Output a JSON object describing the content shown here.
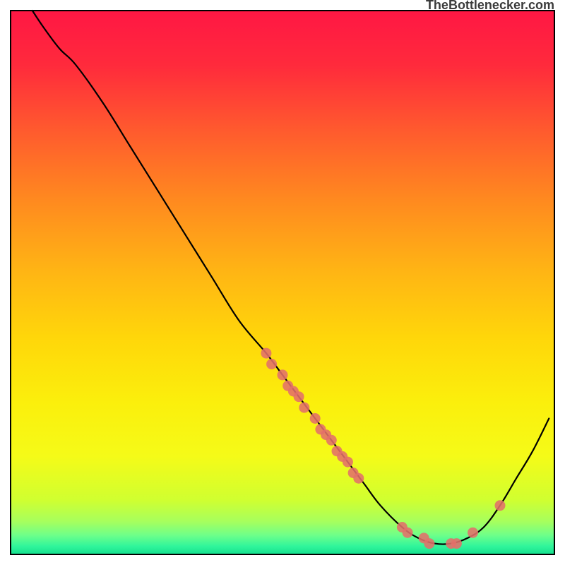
{
  "watermark": "TheBottlenecker.com",
  "chart_data": {
    "type": "line",
    "title": "",
    "xlabel": "",
    "ylabel": "",
    "xlim": [
      0,
      100
    ],
    "ylim": [
      0,
      100
    ],
    "curve": [
      {
        "x": 4,
        "y": 100
      },
      {
        "x": 6,
        "y": 97
      },
      {
        "x": 9,
        "y": 93
      },
      {
        "x": 12,
        "y": 90
      },
      {
        "x": 17,
        "y": 83
      },
      {
        "x": 22,
        "y": 75
      },
      {
        "x": 27,
        "y": 67
      },
      {
        "x": 32,
        "y": 59
      },
      {
        "x": 37,
        "y": 51
      },
      {
        "x": 42,
        "y": 43
      },
      {
        "x": 47,
        "y": 37
      },
      {
        "x": 50,
        "y": 33
      },
      {
        "x": 53,
        "y": 29
      },
      {
        "x": 56,
        "y": 25
      },
      {
        "x": 59,
        "y": 21
      },
      {
        "x": 62,
        "y": 17
      },
      {
        "x": 65,
        "y": 13
      },
      {
        "x": 68,
        "y": 9
      },
      {
        "x": 72,
        "y": 5
      },
      {
        "x": 75,
        "y": 3
      },
      {
        "x": 78,
        "y": 2
      },
      {
        "x": 81,
        "y": 2
      },
      {
        "x": 84,
        "y": 3
      },
      {
        "x": 87,
        "y": 5
      },
      {
        "x": 90,
        "y": 9
      },
      {
        "x": 93,
        "y": 14
      },
      {
        "x": 96,
        "y": 19
      },
      {
        "x": 99,
        "y": 25
      }
    ],
    "points": [
      {
        "x": 47,
        "y": 37
      },
      {
        "x": 48,
        "y": 35
      },
      {
        "x": 50,
        "y": 33
      },
      {
        "x": 51,
        "y": 31
      },
      {
        "x": 52,
        "y": 30
      },
      {
        "x": 53,
        "y": 29
      },
      {
        "x": 54,
        "y": 27
      },
      {
        "x": 56,
        "y": 25
      },
      {
        "x": 57,
        "y": 23
      },
      {
        "x": 58,
        "y": 22
      },
      {
        "x": 59,
        "y": 21
      },
      {
        "x": 60,
        "y": 19
      },
      {
        "x": 61,
        "y": 18
      },
      {
        "x": 62,
        "y": 17
      },
      {
        "x": 63,
        "y": 15
      },
      {
        "x": 64,
        "y": 14
      },
      {
        "x": 72,
        "y": 5
      },
      {
        "x": 73,
        "y": 4
      },
      {
        "x": 76,
        "y": 3
      },
      {
        "x": 77,
        "y": 2
      },
      {
        "x": 81,
        "y": 2
      },
      {
        "x": 82,
        "y": 2
      },
      {
        "x": 85,
        "y": 4
      },
      {
        "x": 90,
        "y": 9
      }
    ],
    "gradient_stops": [
      {
        "offset": 0.0,
        "color": "#ff1744"
      },
      {
        "offset": 0.1,
        "color": "#ff2a3c"
      },
      {
        "offset": 0.22,
        "color": "#ff5a2e"
      },
      {
        "offset": 0.35,
        "color": "#ff8a1f"
      },
      {
        "offset": 0.48,
        "color": "#ffb514"
      },
      {
        "offset": 0.6,
        "color": "#ffd60a"
      },
      {
        "offset": 0.72,
        "color": "#fbef0c"
      },
      {
        "offset": 0.82,
        "color": "#f5fb18"
      },
      {
        "offset": 0.9,
        "color": "#d0ff30"
      },
      {
        "offset": 0.94,
        "color": "#a6ff5e"
      },
      {
        "offset": 0.965,
        "color": "#6dff8a"
      },
      {
        "offset": 0.985,
        "color": "#30f59b"
      },
      {
        "offset": 1.0,
        "color": "#14e08e"
      }
    ],
    "point_color": "#e36f6a",
    "line_color": "#000000",
    "border_color": "#000000",
    "watermark_color": "#3b3b3b"
  }
}
